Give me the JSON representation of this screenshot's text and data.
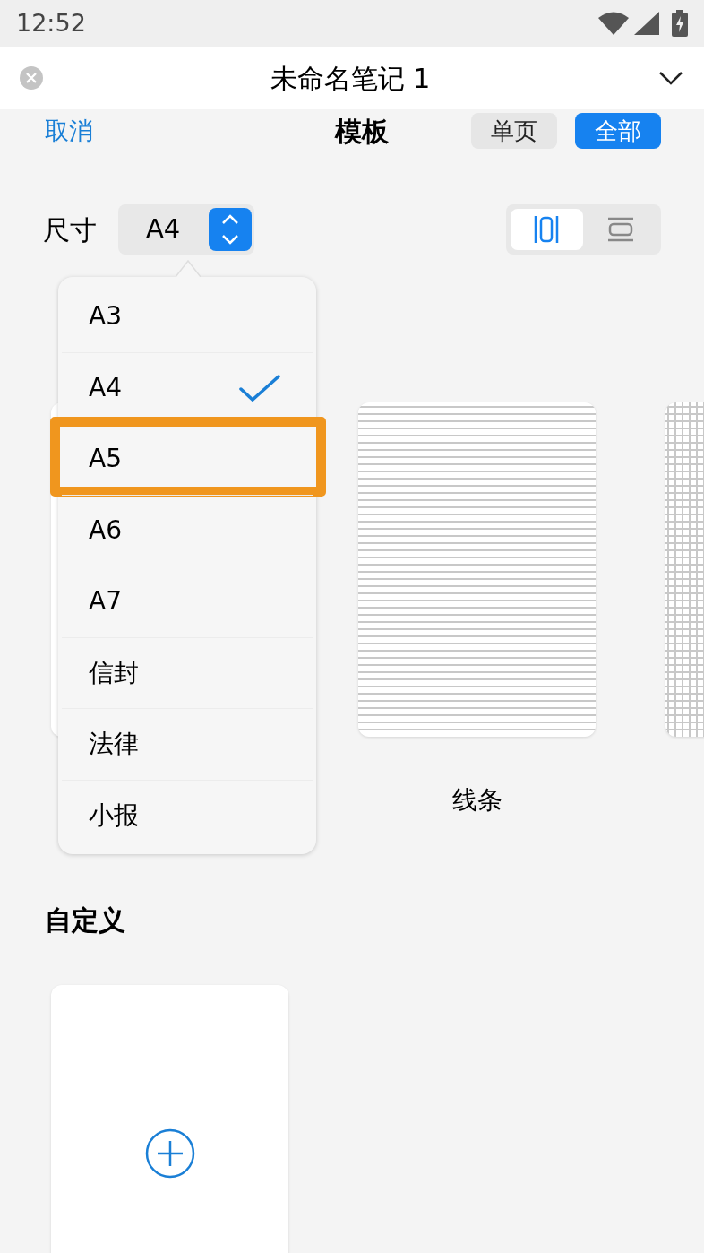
{
  "status_bar": {
    "time": "12:52"
  },
  "title_bar": {
    "title": "未命名笔记 1"
  },
  "header": {
    "cancel": "取消",
    "title": "模板",
    "tabs": [
      {
        "label": "单页",
        "selected": false
      },
      {
        "label": "全部",
        "selected": true
      }
    ]
  },
  "size": {
    "label": "尺寸",
    "value": "A4"
  },
  "orientation": [
    {
      "kind": "portrait",
      "selected": true
    },
    {
      "kind": "landscape",
      "selected": false
    }
  ],
  "templates": [
    {
      "kind": "blank"
    },
    {
      "kind": "lines",
      "label": "线条"
    },
    {
      "kind": "grid"
    }
  ],
  "custom": {
    "heading": "自定义"
  },
  "size_menu": {
    "items": [
      {
        "label": "A3",
        "selected": false,
        "highlighted": false
      },
      {
        "label": "A4",
        "selected": true,
        "highlighted": false
      },
      {
        "label": "A5",
        "selected": false,
        "highlighted": true
      },
      {
        "label": "A6",
        "selected": false,
        "highlighted": false
      },
      {
        "label": "A7",
        "selected": false,
        "highlighted": false
      },
      {
        "label": "信封",
        "selected": false,
        "highlighted": false
      },
      {
        "label": "法律",
        "selected": false,
        "highlighted": false
      },
      {
        "label": "小报",
        "selected": false,
        "highlighted": false
      }
    ]
  }
}
